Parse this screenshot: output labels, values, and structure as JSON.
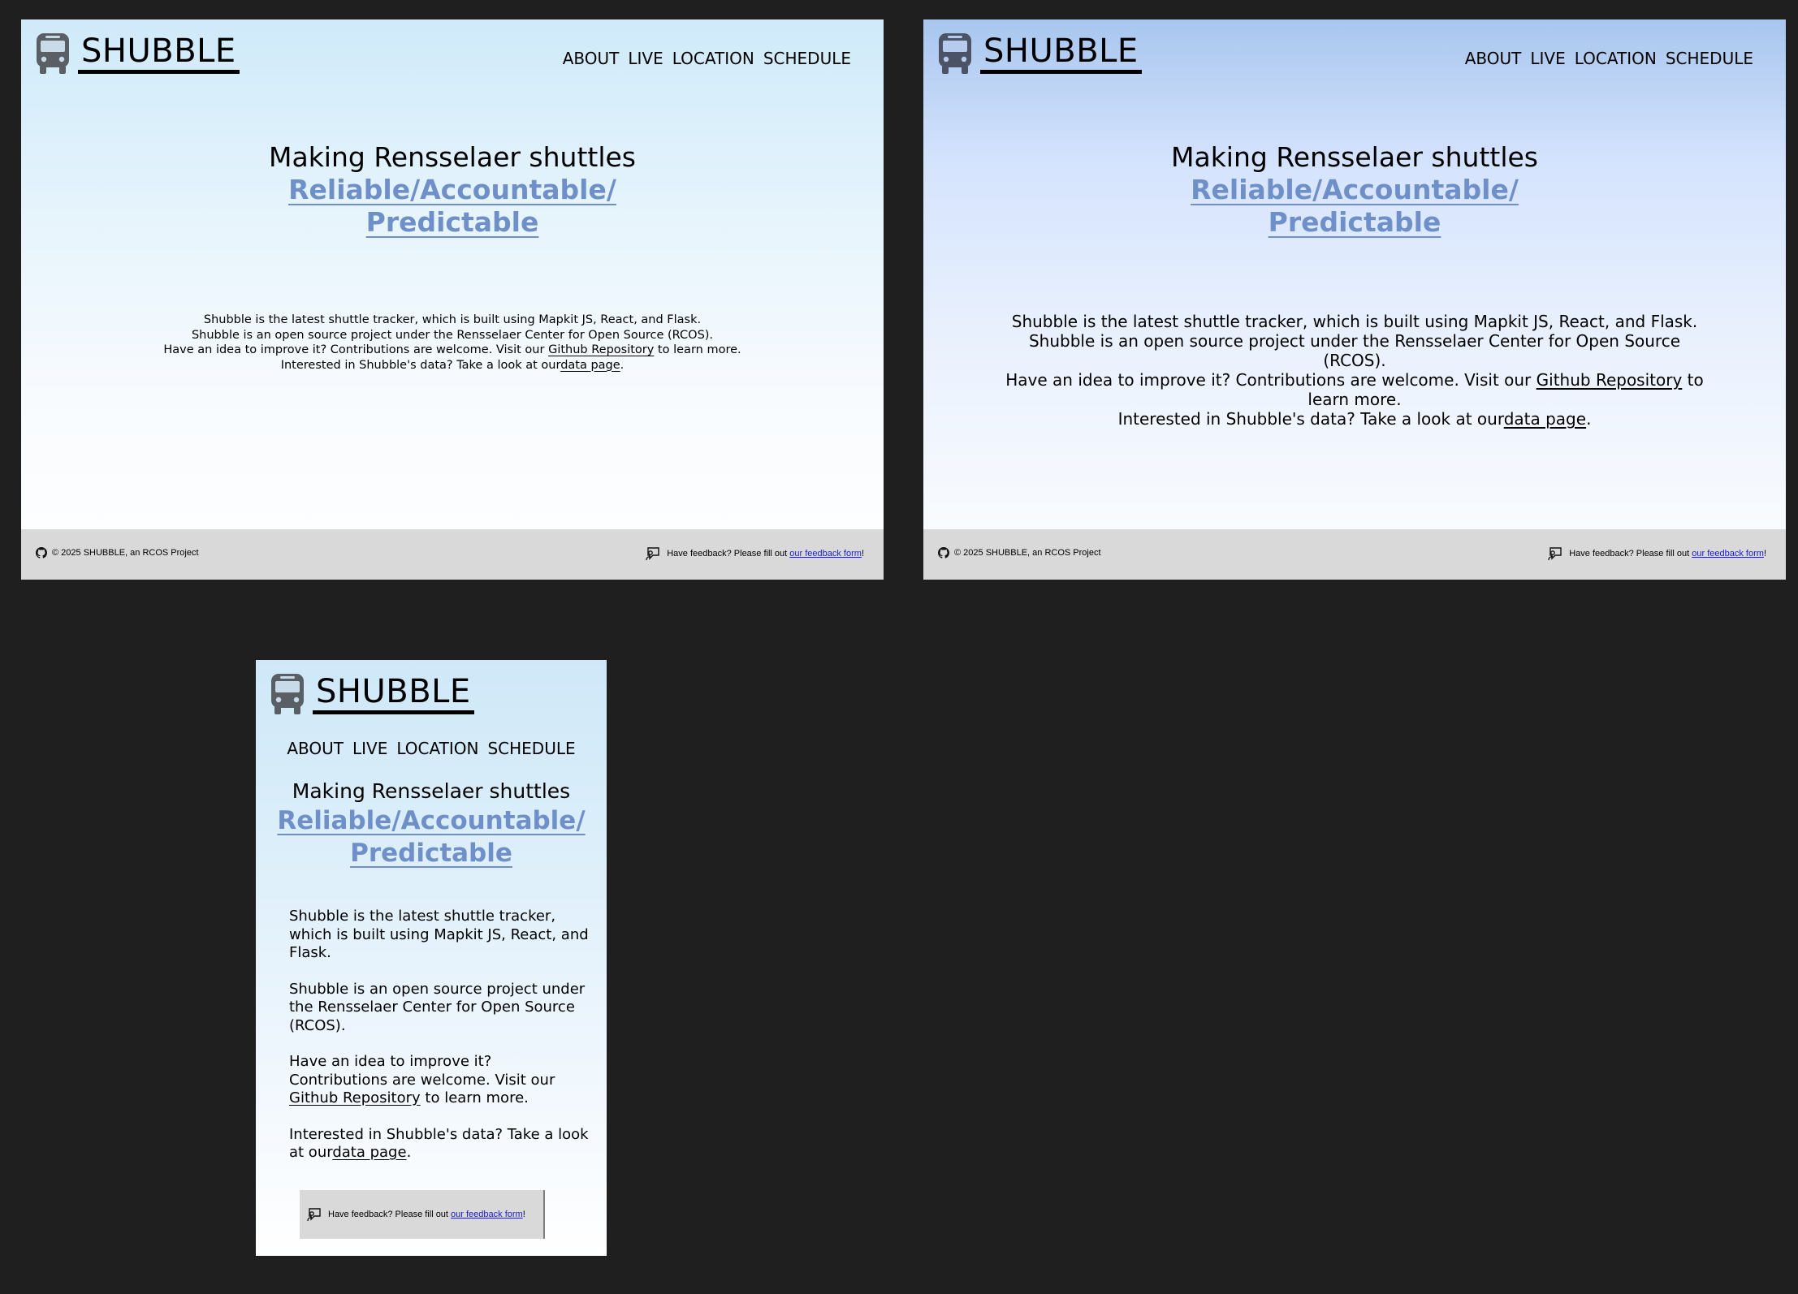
{
  "brand": {
    "name": "SHUBBLE"
  },
  "nav": {
    "items": [
      {
        "label": "ABOUT"
      },
      {
        "label": "LIVE"
      },
      {
        "label": "LOCATION"
      },
      {
        "label": "SCHEDULE"
      }
    ]
  },
  "hero": {
    "line1": "Making Rensselaer shuttles",
    "line2a": "Reliable/Accountable/",
    "line2b": "Predictable",
    "line2_full": "Reliable/Accountable/Predictable"
  },
  "about": {
    "p1": "Shubble is the latest shuttle tracker, which is built using Mapkit JS, React, and Flask.",
    "p2": "Shubble is an open source project under the Rensselaer Center for Open Source (RCOS).",
    "p3_before": "Have an idea to improve it? Contributions are welcome. Visit our ",
    "p3_link": "Github Repository",
    "p3_after": " to learn more.",
    "p4_before": "Interested in Shubble's data? Take a look at our",
    "p4_link": "data page",
    "p4_after": "."
  },
  "footer": {
    "copyright": "© 2025 SHUBBLE, an RCOS Project",
    "feedback_before": "Have feedback? Please fill out ",
    "feedback_link": "our feedback form",
    "feedback_after": "!"
  },
  "colors": {
    "accent": "#6f8fc9",
    "footer_bg": "#d9d9d9",
    "link": "#1a1ad6",
    "bus_icon": "#5a5f66",
    "page_bg": "#1f1f1f"
  },
  "icons": [
    "bus-icon",
    "github-icon",
    "feedback-icon"
  ]
}
